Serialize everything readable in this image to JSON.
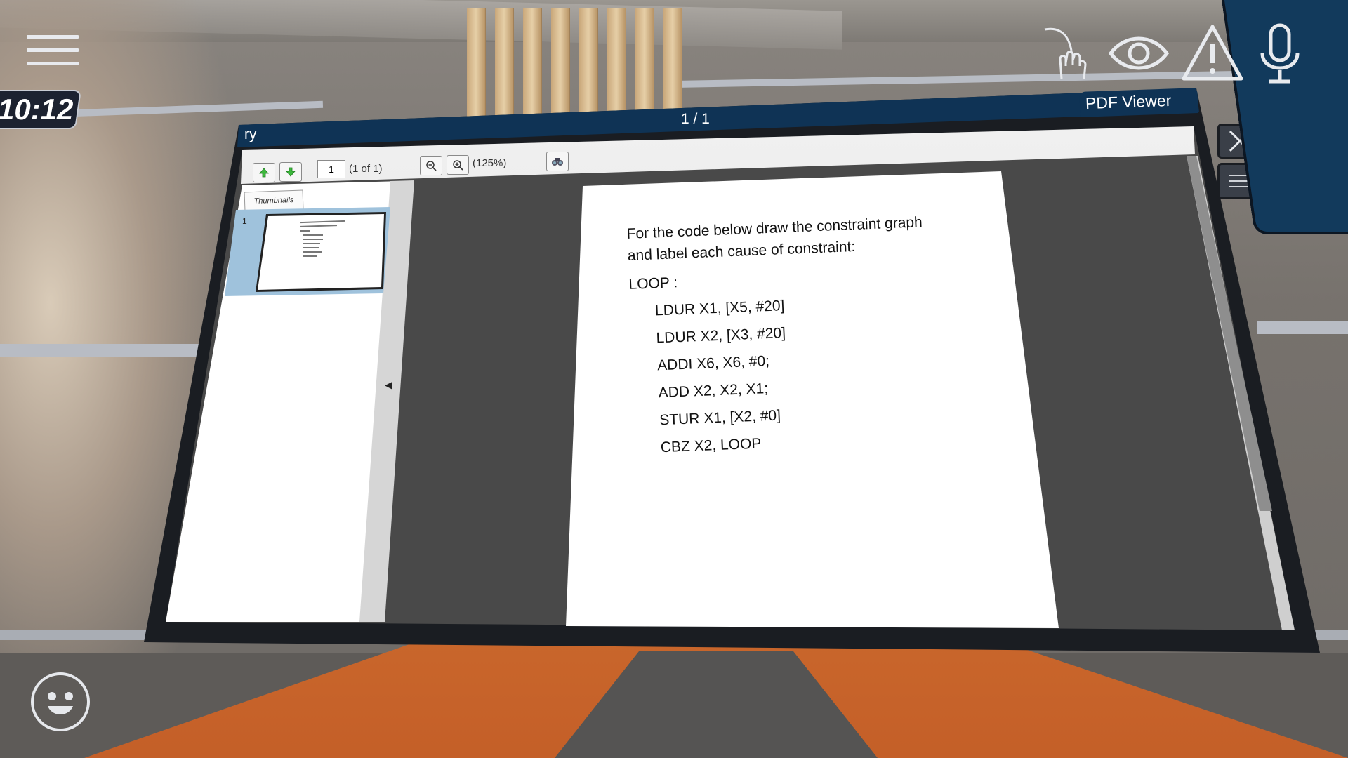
{
  "hud": {
    "clock": "10:12",
    "icons": [
      "menu-icon",
      "hand-raise-icon",
      "eye-icon",
      "warning-icon",
      "microphone-icon",
      "emoji-icon"
    ]
  },
  "pdf_viewer": {
    "window_title": "ry",
    "page_indicator": "1 / 1",
    "label": "PDF Viewer",
    "toolbar": {
      "page_input_value": "1",
      "page_of": "(1 of 1)",
      "zoom": "(125%)"
    },
    "sidebar": {
      "tab_label": "Thumbnails",
      "thumbnails": [
        {
          "number": "1"
        }
      ]
    },
    "document": {
      "heading_lines": [
        "For the code below draw the constraint graph",
        "and label each cause of constraint:"
      ],
      "label": "LOOP :",
      "code": [
        "LDUR X1, [X5, #20]",
        "LDUR X2, [X3, #20]",
        "ADDI X6, X6, #0;",
        "ADD X2, X2, X1;",
        "STUR X1, [X2, #0]",
        "CBZ X2, LOOP"
      ]
    },
    "colors": {
      "header": "#0f3355",
      "screen_bg": "#494949",
      "thumb_highlight": "#9fc2dc"
    }
  }
}
